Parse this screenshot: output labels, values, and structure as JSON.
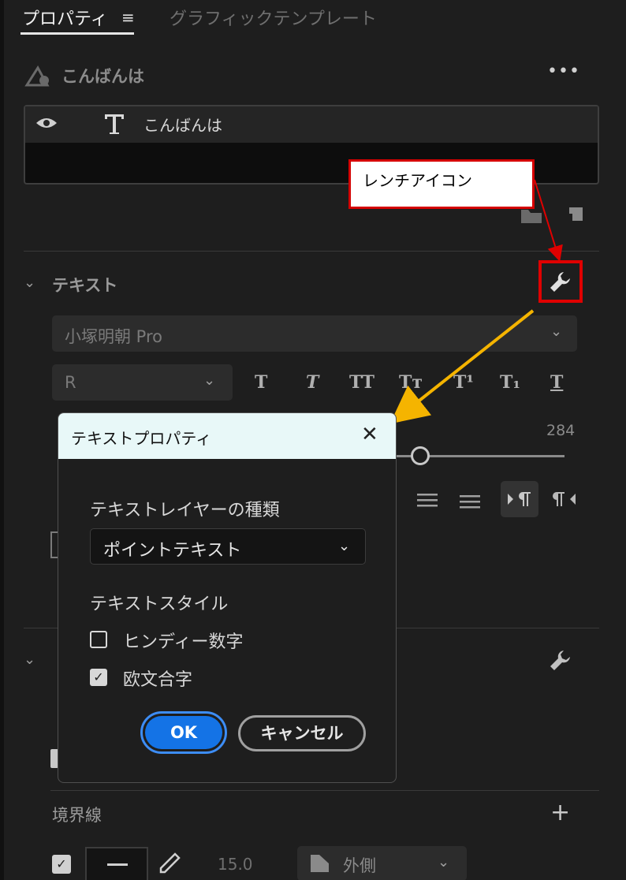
{
  "tabs": {
    "properties": "プロパティ",
    "menu_glyph": "≡",
    "graphic_templates": "グラフィックテンプレート"
  },
  "layer": {
    "name": "こんばんは",
    "more": "•••",
    "row_text": "こんばんは",
    "icons": [
      "shape-text-icon",
      "eye-icon",
      "text-type-icon",
      "folder-icon",
      "new-layer-icon"
    ]
  },
  "callout": {
    "label": "レンチアイコン"
  },
  "text_section": {
    "title": "テキスト",
    "font_family": "小塚明朝 Pro",
    "font_style": "R",
    "style_buttons": [
      "T",
      "T",
      "TT",
      "Tт",
      "T¹",
      "T₁",
      "T"
    ],
    "value": "284"
  },
  "dialog": {
    "title": "テキストプロパティ",
    "close": "✕",
    "layer_type_label": "テキストレイヤーの種類",
    "layer_type_value": "ポイントテキスト",
    "text_style_label": "テキストスタイル",
    "hindi_digits": {
      "label": "ヒンディー数字",
      "checked": false
    },
    "ligatures": {
      "label": "欧文合字",
      "checked": true
    },
    "ok": "OK",
    "cancel": "キャンセル"
  },
  "stroke": {
    "title": "境界線",
    "add": "+",
    "width": "15.0",
    "position": "外側"
  },
  "colors": {
    "highlight_red": "#e00000",
    "arrow_orange": "#f5b400",
    "ok_blue": "#1473e6",
    "dialog_header": "#e8f8f8"
  }
}
